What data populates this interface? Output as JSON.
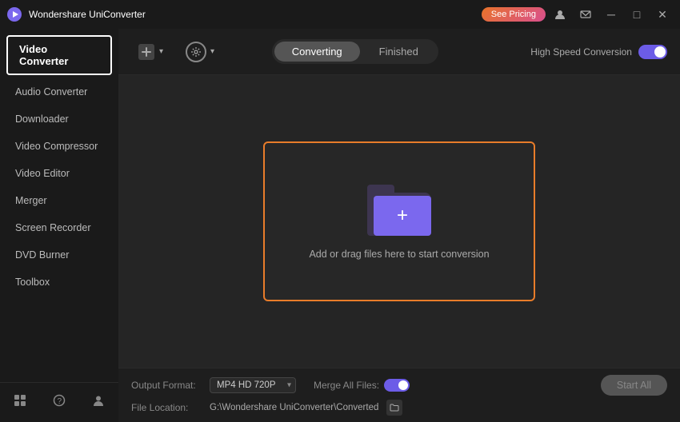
{
  "app": {
    "title": "Wondershare UniConverter",
    "logo_unicode": "▶"
  },
  "titlebar": {
    "see_pricing_label": "See Pricing",
    "user_icon": "👤",
    "mail_icon": "✉",
    "minimize_icon": "─",
    "maximize_icon": "□",
    "close_icon": "✕"
  },
  "sidebar": {
    "active_item": "Video Converter",
    "items": [
      {
        "label": "Audio Converter"
      },
      {
        "label": "Downloader"
      },
      {
        "label": "Video Compressor"
      },
      {
        "label": "Video Editor"
      },
      {
        "label": "Merger"
      },
      {
        "label": "Screen Recorder"
      },
      {
        "label": "DVD Burner"
      },
      {
        "label": "Toolbox"
      }
    ],
    "bottom_icons": [
      "layout-icon",
      "help-icon",
      "person-icon"
    ]
  },
  "toolbar": {
    "add_btn_label": "▼",
    "settings_btn_label": "▼",
    "tab_converting": "Converting",
    "tab_finished": "Finished",
    "high_speed_label": "High Speed Conversion"
  },
  "dropzone": {
    "text": "Add or drag files here to start conversion"
  },
  "bottom": {
    "output_format_label": "Output Format:",
    "output_format_value": "MP4 HD 720P",
    "merge_label": "Merge All Files:",
    "file_location_label": "File Location:",
    "file_path": "G:\\Wondershare UniConverter\\Converted",
    "start_all_label": "Start All"
  }
}
